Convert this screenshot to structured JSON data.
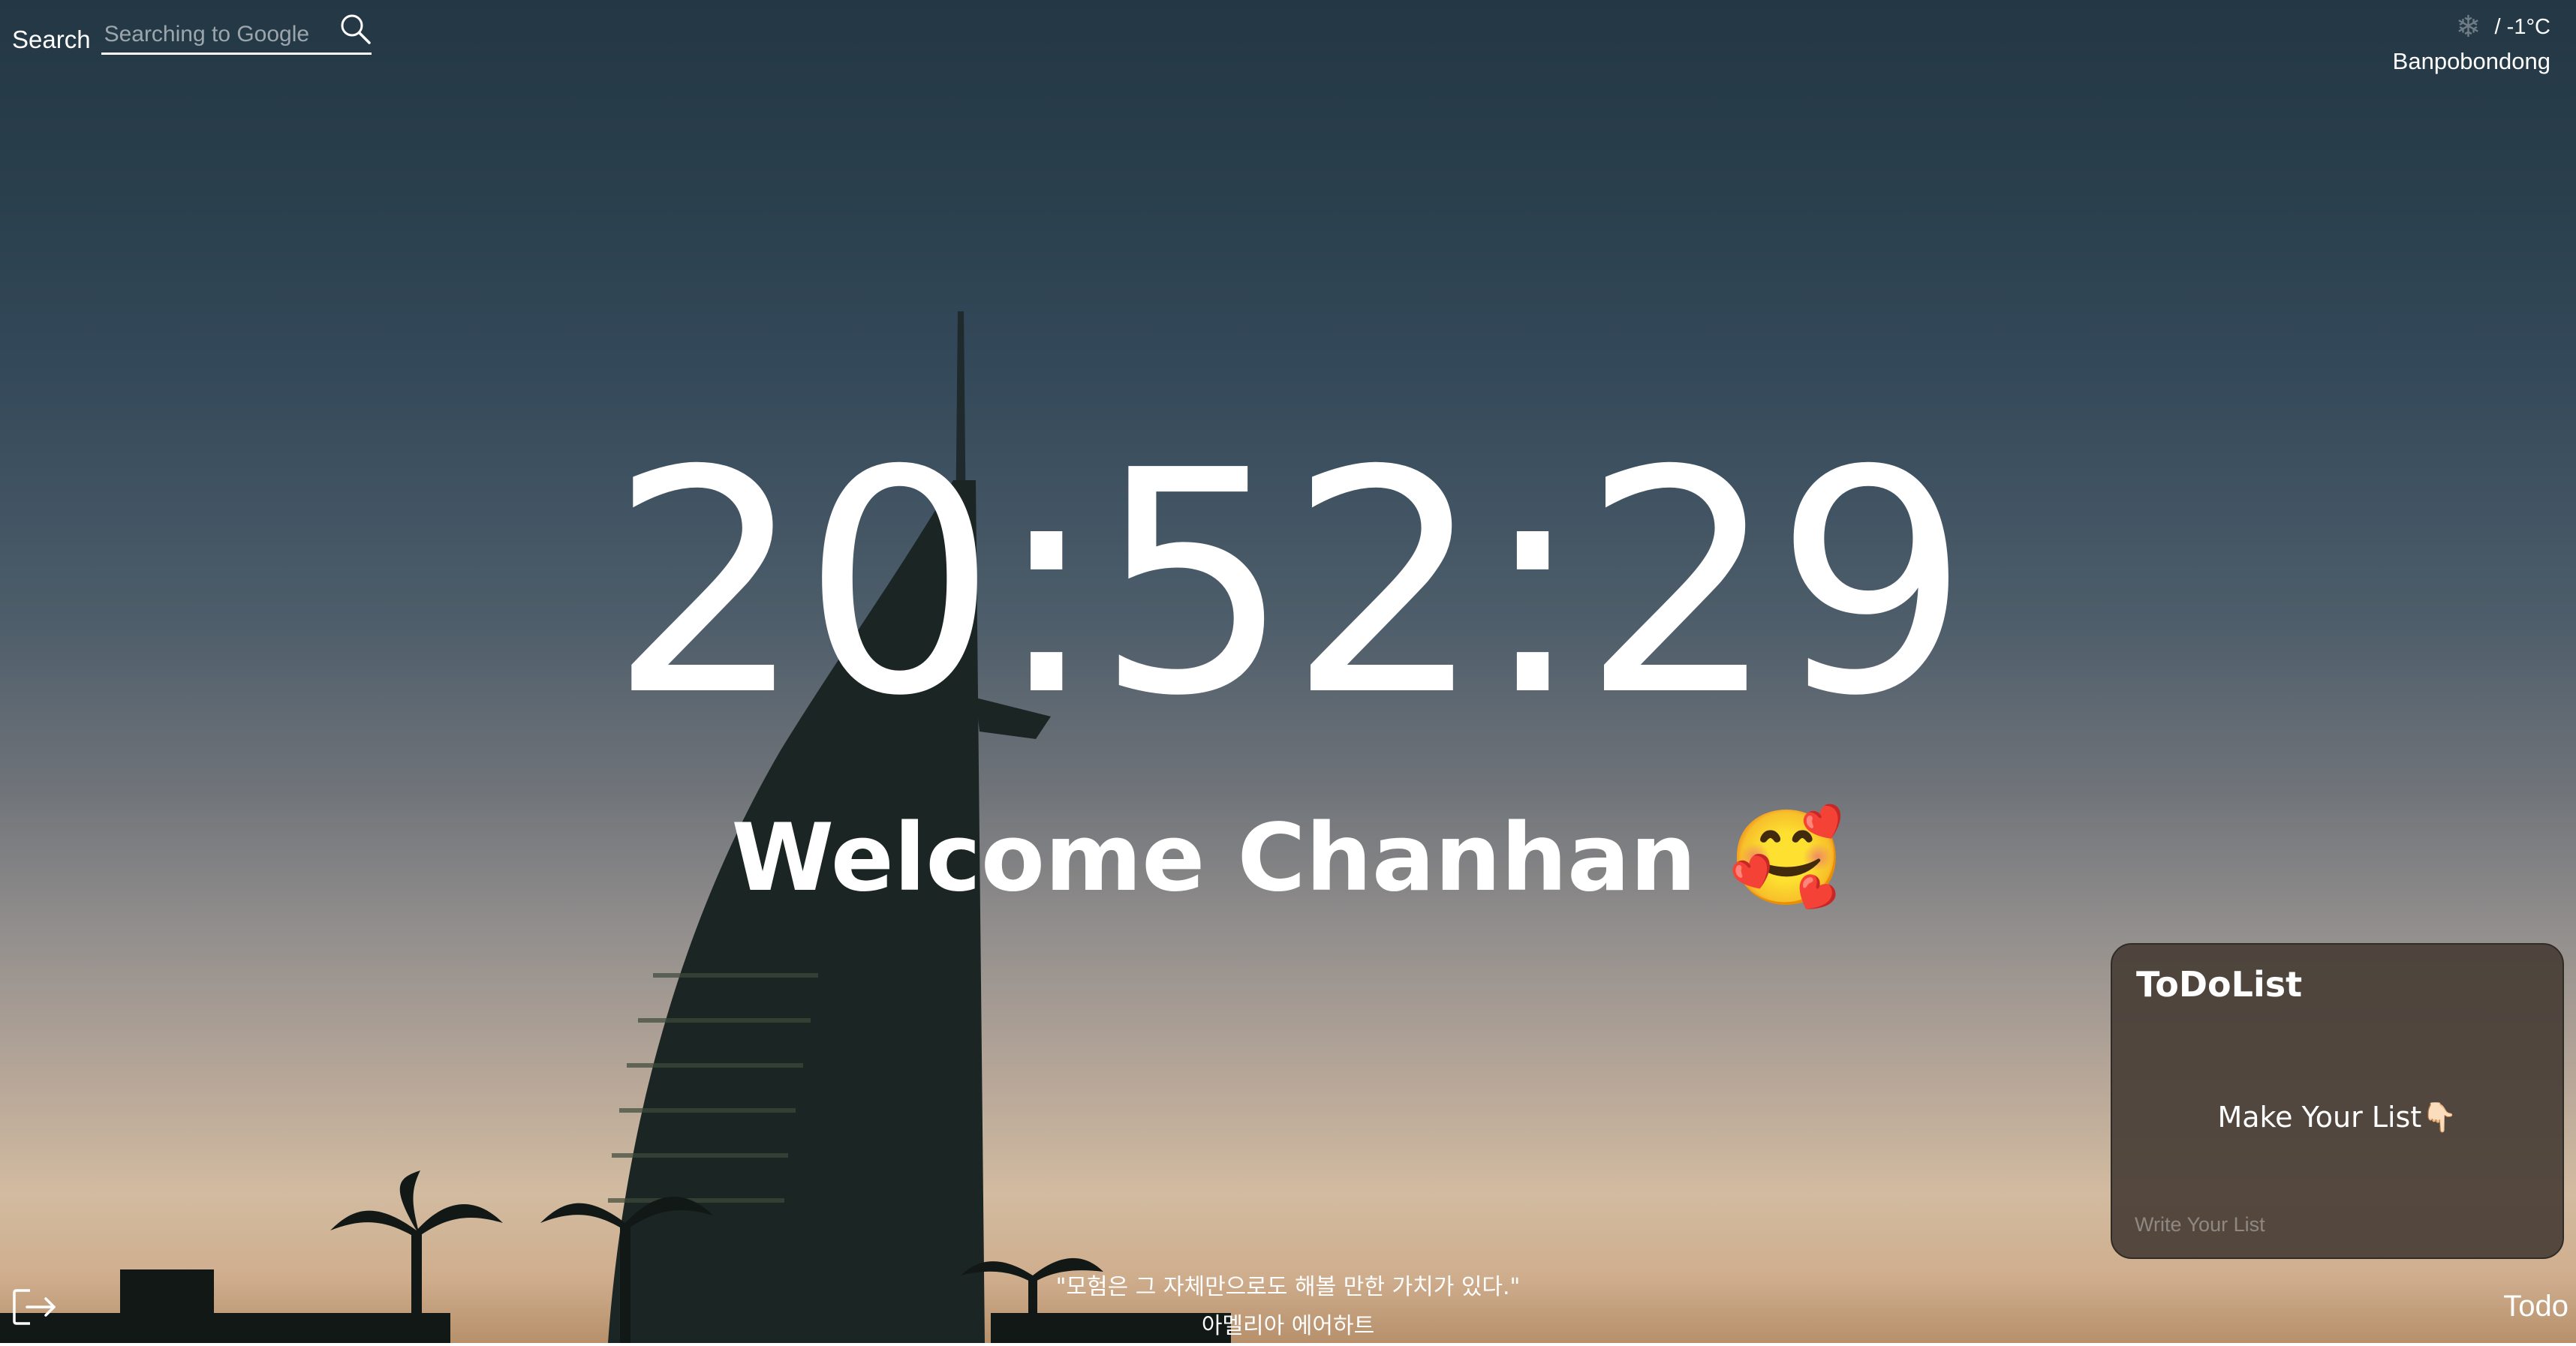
{
  "search": {
    "label": "Search",
    "placeholder": "Searching to Google",
    "icon": "search-icon"
  },
  "weather": {
    "icon": "snowflake-icon",
    "temperature": "/ -1°C",
    "location": "Banpobondong"
  },
  "clock": {
    "time": "20:52:29"
  },
  "greeting": {
    "text": "Welcome Chanhan 🥰"
  },
  "todo": {
    "title": "ToDoList",
    "empty_message": "Make Your List👇🏻",
    "input_placeholder": "Write Your List",
    "toggle_label": "Todo"
  },
  "quote": {
    "text": "\"모험은 그 자체만으로도 해볼 만한 가치가 있다.\"",
    "author": "아멜리아 에어하트"
  },
  "footer": {
    "logout_icon": "logout-icon"
  },
  "colors": {
    "sky_top": "#233745",
    "sky_horizon": "#d2bba0",
    "panel_bg": "#463c34",
    "text": "#ffffff"
  }
}
